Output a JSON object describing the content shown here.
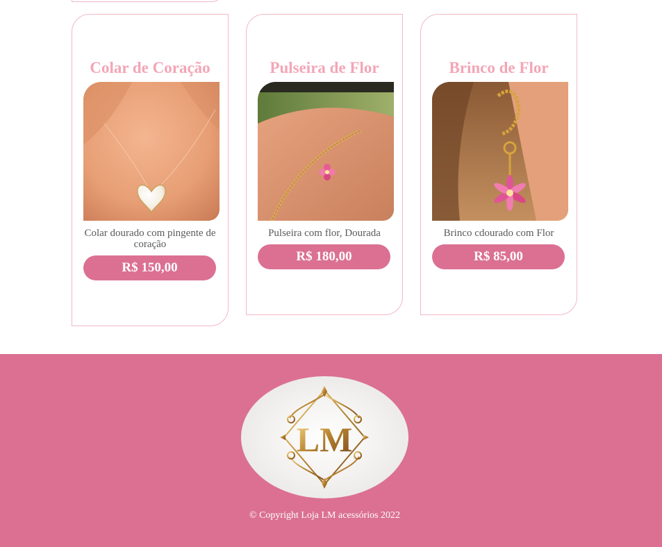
{
  "products": [
    {
      "title": "Colar de Coração",
      "description": "Colar dourado com pingente de coração",
      "price": "R$ 150,00",
      "image_icon": "heart-necklace-photo"
    },
    {
      "title": "Pulseira de Flor",
      "description": "Pulseira com flor, Dourada",
      "price": "R$ 180,00",
      "image_icon": "flower-bracelet-photo"
    },
    {
      "title": "Brinco de Flor",
      "description": "Brinco cdourado com Flor",
      "price": "R$ 85,00",
      "image_icon": "flower-earring-photo"
    }
  ],
  "footer": {
    "logo_text": "LM",
    "copyright": "© Copyright Loja LM acessórios 2022"
  },
  "colors": {
    "accent": "#db7093",
    "title_pink": "#f3a6b6",
    "card_border": "#f2b8c6"
  }
}
